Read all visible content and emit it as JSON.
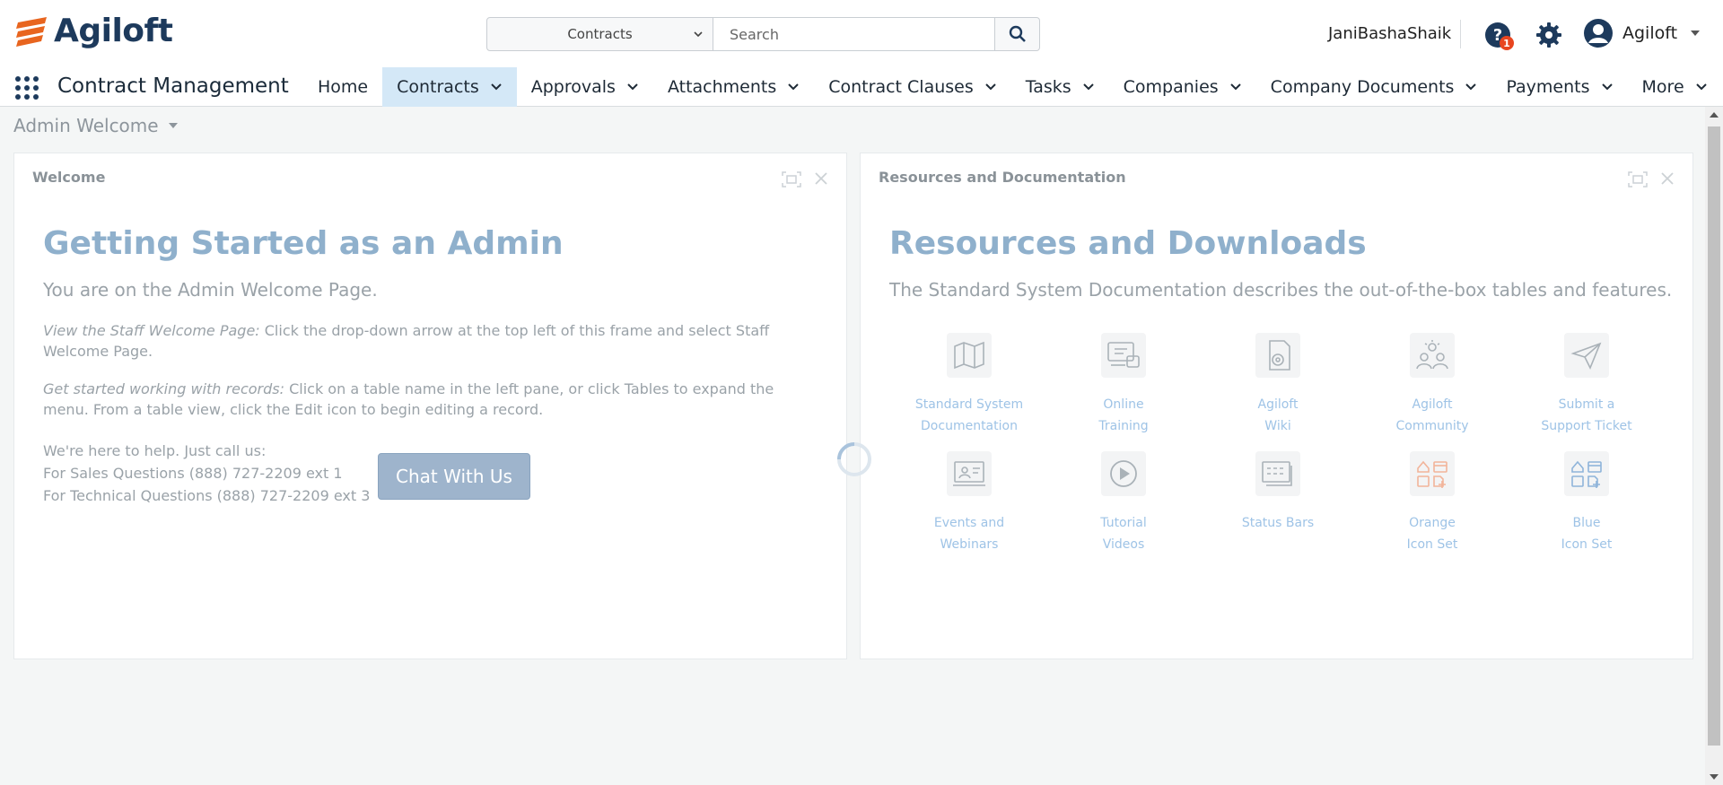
{
  "header": {
    "logo_text": "Agiloft",
    "search": {
      "table_selected": "Contracts",
      "placeholder": "Search"
    },
    "user_name": "JaniBashaShaik",
    "help_badge": "1",
    "account_label": "Agiloft"
  },
  "nav": {
    "app_name": "Contract Management",
    "items": [
      {
        "label": "Home"
      },
      {
        "label": "Contracts"
      },
      {
        "label": "Approvals"
      },
      {
        "label": "Attachments"
      },
      {
        "label": "Contract Clauses"
      },
      {
        "label": "Tasks"
      },
      {
        "label": "Companies"
      },
      {
        "label": "Company Documents"
      },
      {
        "label": "Payments"
      },
      {
        "label": "More"
      }
    ]
  },
  "page": {
    "title": "Admin Welcome"
  },
  "welcome": {
    "panel_title": "Welcome",
    "heading": "Getting Started as an Admin",
    "subheading": "You are on the Admin Welcome Page.",
    "p1_em": "View the Staff Welcome Page:",
    "p1_text": " Click the drop-down arrow at the top left of this frame and select Staff Welcome Page.",
    "p2_em": "Get started working with records:",
    "p2_text": " Click on a table name in the left pane, or click Tables to expand the menu. From a table view, click the Edit icon to begin editing a record.",
    "contact_intro": "We're here to help. Just call us:",
    "sales": "For Sales Questions (888) 727-2209 ext 1",
    "tech": "For Technical Questions (888) 727-2209 ext 3",
    "chat_button": "Chat With Us"
  },
  "resources": {
    "panel_title": "Resources and Documentation",
    "heading": "Resources and Downloads",
    "subheading": "The Standard System Documentation describes the out-of-the-box tables and features.",
    "items": [
      {
        "line1": "Standard System",
        "line2": "Documentation",
        "icon": "map-icon"
      },
      {
        "line1": "Online",
        "line2": "Training",
        "icon": "training-icon"
      },
      {
        "line1": "Agiloft",
        "line2": "Wiki",
        "icon": "wiki-icon"
      },
      {
        "line1": "Agiloft",
        "line2": "Community",
        "icon": "community-icon"
      },
      {
        "line1": "Submit a",
        "line2": "Support Ticket",
        "icon": "paper-plane-icon"
      },
      {
        "line1": "Events and",
        "line2": "Webinars",
        "icon": "webinar-icon"
      },
      {
        "line1": "Tutorial",
        "line2": "Videos",
        "icon": "play-icon"
      },
      {
        "line1": "Status Bars",
        "line2": "",
        "icon": "status-bars-icon"
      },
      {
        "line1": "Orange",
        "line2": "Icon Set",
        "icon": "orange-icon-set-icon"
      },
      {
        "line1": "Blue",
        "line2": "Icon Set",
        "icon": "blue-icon-set-icon"
      }
    ]
  },
  "colors": {
    "brand_orange": "#e8651f",
    "brand_navy": "#1d3a5c",
    "active_tab": "#d4e8f7",
    "heading_blue": "#8fb0cc",
    "link_blue": "#9ec3e6",
    "badge_red": "#e8451f"
  }
}
